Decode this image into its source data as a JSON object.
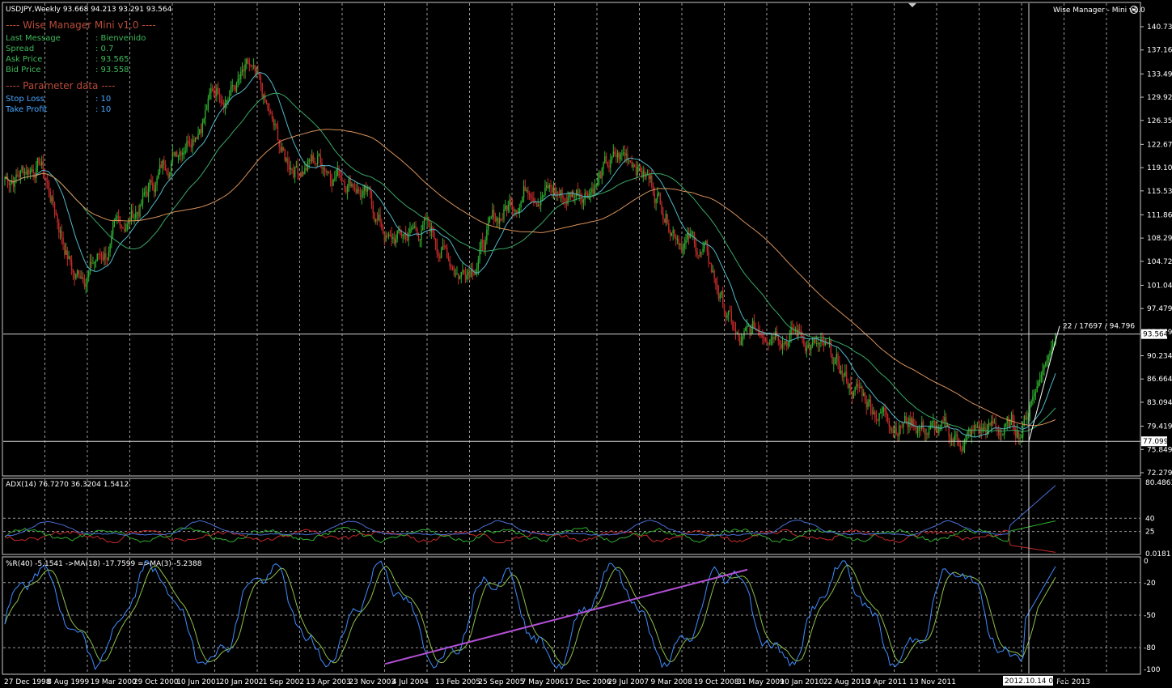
{
  "header": {
    "symbol_line": "USDJPY,Weekly  93.668 94.213 93.291 93.564",
    "ea_badge": "Wise Manager - Mini v1.0"
  },
  "ea_panel": {
    "title": "---- Wise Manager Mini v1.0 ----",
    "rows": [
      {
        "label": "Last Message",
        "value": ": Bienvenido"
      },
      {
        "label": "Spread",
        "value": ": 0.7"
      },
      {
        "label": "Ask Price",
        "value": ": 93.565"
      },
      {
        "label": "Bid Price",
        "value": ": 93.558"
      }
    ],
    "param_title": "---- Parameter data ----",
    "params": [
      {
        "label": "Stop Loss",
        "value": ": 10"
      },
      {
        "label": "Take Profit",
        "value": ": 10"
      }
    ]
  },
  "price_axis": {
    "ticks": [
      "140.739",
      "137.169",
      "133.494",
      "129.924",
      "126.354",
      "122.679",
      "119.109",
      "115.539",
      "111.864",
      "108.294",
      "104.724",
      "101.049",
      "97.479",
      "93.909",
      "90.234",
      "86.664",
      "83.094",
      "79.419",
      "75.849",
      "72.279"
    ],
    "current_price": "93.564",
    "support_price": "77.099",
    "trend_label": "22 / 17697 / 94.796"
  },
  "adx_panel": {
    "header": "ADX(14) 76.7270 36.3204 1.5412",
    "ticks": [
      "80.4863",
      "40",
      "25",
      "0.0181"
    ]
  },
  "wpr_panel": {
    "header": "%R(40) -5.1541  ->MA(18) -17.7599  =>MA(3) -5.2388",
    "ticks": [
      "0",
      "-20",
      "-50",
      "-80",
      "-100"
    ]
  },
  "date_axis": {
    "labels": [
      "27 Dec 1998",
      "8 Aug 1999",
      "19 Mar 2000",
      "29 Oct 2000",
      "10 Jun 2001",
      "20 Jan 2002",
      "1 Sep 2002",
      "13 Apr 2003",
      "23 Nov 2003",
      "4 Jul 2004",
      "13 Feb 2005",
      "25 Sep 2005",
      "7 May 2006",
      "17 Dec 2006",
      "29 Jul 2007",
      "9 Mar 2008",
      "19 Oct 2008",
      "31 May 2009",
      "10 Jan 2010",
      "22 Aug 2010",
      "3 Apr 2011",
      "13 Nov 2011",
      "2012.10.14 00:00",
      "Feb 2013"
    ],
    "cursor_label": "2012.10.14 00:00"
  },
  "colors": {
    "bull": "#2fae2f",
    "bear": "#c62a2a",
    "ma_fast": "#52b8c8",
    "ma_mid": "#3aa866",
    "ma_slow": "#d8925a",
    "adx_main": "#4a6fd8",
    "di_plus": "#2fae2f",
    "di_minus": "#c62a2a",
    "wpr": "#3f8cff",
    "wpr_ma": "#8fbf4a",
    "trendline": "#b34fd6"
  },
  "chart_data": {
    "type": "candlestick",
    "symbol": "USDJPY",
    "timeframe": "Weekly",
    "ohlc_last": {
      "open": 93.668,
      "high": 94.213,
      "low": 93.291,
      "close": 93.564
    },
    "ylim": [
      72.279,
      140.739
    ],
    "x": [
      "1998-12",
      "1999-06",
      "1999-12",
      "2000-06",
      "2000-12",
      "2001-06",
      "2001-12",
      "2002-03",
      "2002-06",
      "2002-12",
      "2003-06",
      "2003-12",
      "2004-06",
      "2004-12",
      "2005-06",
      "2005-12",
      "2006-06",
      "2006-12",
      "2007-06",
      "2007-12",
      "2008-06",
      "2008-12",
      "2009-06",
      "2009-12",
      "2010-06",
      "2010-12",
      "2011-06",
      "2011-12",
      "2012-06",
      "2012-10",
      "2013-02"
    ],
    "close": [
      117.5,
      120.5,
      102.5,
      107.0,
      114.5,
      123.5,
      131.5,
      133.0,
      119.5,
      120.5,
      118.0,
      107.5,
      110.0,
      103.5,
      110.5,
      118.0,
      114.5,
      118.5,
      121.0,
      112.0,
      105.5,
      91.0,
      96.5,
      92.5,
      86.0,
      82.0,
      80.5,
      77.0,
      78.5,
      79.0,
      93.564
    ],
    "series": [
      {
        "name": "ADX(14)",
        "last": 76.727
      },
      {
        "name": "+DI",
        "last": 36.3204
      },
      {
        "name": "-DI",
        "last": 1.5412
      },
      {
        "name": "%R(40)",
        "last": -5.1541
      },
      {
        "name": "MA(18)",
        "last": -17.7599
      },
      {
        "name": "MA(3)",
        "last": -5.2388
      }
    ]
  }
}
